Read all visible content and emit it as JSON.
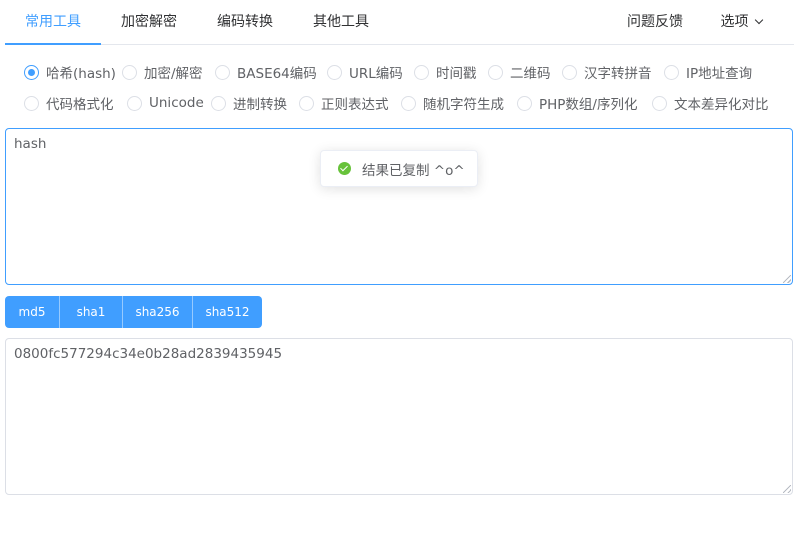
{
  "nav": {
    "tabs": [
      {
        "label": "常用工具",
        "active": true
      },
      {
        "label": "加密解密"
      },
      {
        "label": "编码转换"
      },
      {
        "label": "其他工具"
      }
    ],
    "feedback": "问题反馈",
    "options": "选项"
  },
  "tools": {
    "row1": [
      "哈希(hash)",
      "加密/解密",
      "BASE64编码",
      "URL编码",
      "时间戳",
      "二维码",
      "汉字转拼音",
      "IP地址查询"
    ],
    "row2": [
      "代码格式化",
      "Unicode",
      "进制转换",
      "正则表达式",
      "随机字符生成",
      "PHP数组/序列化",
      "文本差异化对比"
    ],
    "selected": "哈希(hash)"
  },
  "input": {
    "value": "hash"
  },
  "toast": {
    "message": "结果已复制 ^o^",
    "icon": "success-check-icon"
  },
  "hash_buttons": [
    "md5",
    "sha1",
    "sha256",
    "sha512"
  ],
  "output": {
    "value": "0800fc577294c34e0b28ad2839435945"
  },
  "colors": {
    "primary": "#409eff",
    "success": "#67c23a",
    "text": "#606266"
  }
}
